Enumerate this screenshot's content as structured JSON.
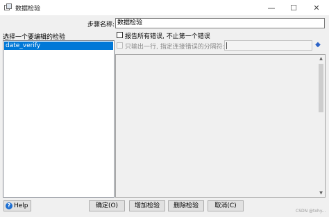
{
  "window": {
    "title": "数据检验",
    "minimize_glyph": "—",
    "maximize_glyph": "☐",
    "close_glyph": "✕"
  },
  "step": {
    "label": "步骤名称:",
    "value": "数据检验"
  },
  "validations": {
    "label": "选择一个要编辑的检验",
    "items": [
      "date_verify"
    ]
  },
  "options": {
    "report_all_errors_label": "报告所有错误, 不止第一个错误",
    "single_row_output_label": "只输出一行, 指定连接错误的分隔符:",
    "separator_value": ""
  },
  "buttons": {
    "help": "Help",
    "ok": "确定(O)",
    "add": "增加检验",
    "delete": "删除检验",
    "cancel": "取消(C)"
  },
  "watermark": "CSDN @tohy..."
}
